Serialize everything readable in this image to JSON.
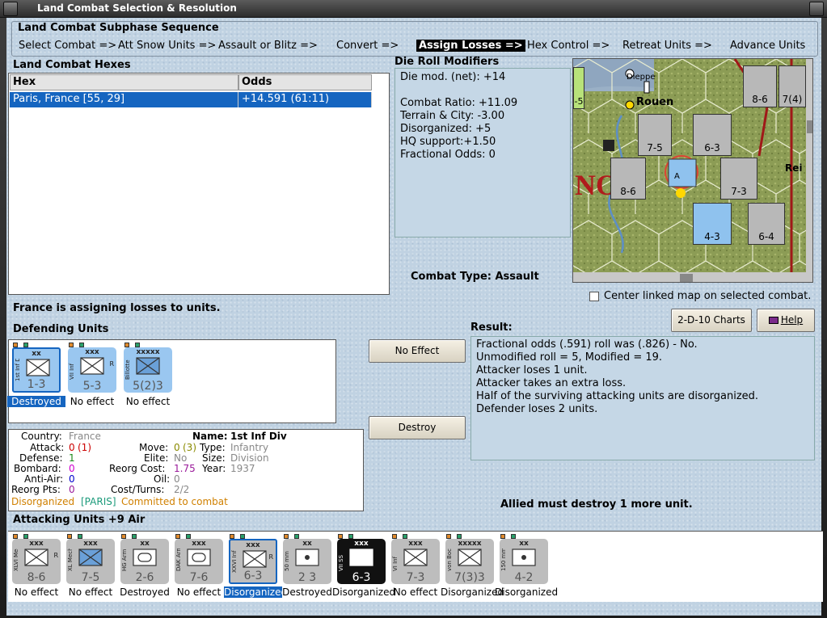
{
  "window": {
    "title": "Land Combat Selection & Resolution"
  },
  "sequence": {
    "header": "Land Combat Subphase Sequence",
    "steps": [
      {
        "label": "Select Combat =>"
      },
      {
        "label": "Att Snow Units =>"
      },
      {
        "label": "Assault or Blitz =>"
      },
      {
        "label": "Convert =>"
      },
      {
        "label": "Assign Losses =>"
      },
      {
        "label": "Hex Control =>"
      },
      {
        "label": "Retreat Units =>"
      },
      {
        "label": "Advance Units"
      }
    ],
    "active_step": "Assign Losses =>"
  },
  "hexes": {
    "header": "Land Combat Hexes",
    "columns": [
      "Hex",
      "Odds"
    ],
    "rows": [
      {
        "hex": "Paris, France [55, 29]",
        "odds": "+14.591 (61:11)"
      }
    ]
  },
  "drm": {
    "header": "Die Roll Modifiers",
    "lines": [
      "Die mod. (net): +14",
      "Combat Ratio: +11.09",
      "Terrain & City: -3.00",
      "Disorganized: +5",
      "HQ support:+1.50",
      "Fractional Odds: 0"
    ]
  },
  "combat_type": "Combat Type:  Assault",
  "center_map": {
    "label": "Center linked map on selected combat.",
    "checked": false
  },
  "buttons": {
    "charts": "2-D-10 Charts",
    "help": "Help",
    "no_effect": "No Effect",
    "destroy": "Destroy"
  },
  "status_msg": "France is assigning losses to units.",
  "defending": {
    "header": "Defending Units",
    "units": [
      {
        "name": "1st Inf Div",
        "size": "xx",
        "stats": "1-3",
        "status": "Destroyed",
        "color": "#9ac7f0",
        "mark": "x",
        "selected": true
      },
      {
        "name": "VII Inf",
        "size": "xxx",
        "stats": "5-3",
        "status": "No effect",
        "color": "#9ac7f0",
        "mark": "x",
        "reserve": "R"
      },
      {
        "name": "Billotte",
        "size": "xxxxx",
        "stats": "5(2)3",
        "status": "No effect",
        "color": "#9ac7f0",
        "mark": "xfill"
      }
    ]
  },
  "info": {
    "country_label": "Country:",
    "country": "France",
    "name_label": "Name:",
    "name": "1st Inf Div",
    "attack_label": "Attack:",
    "attack": "0",
    "attack_extra": "(1)",
    "move_label": "Move:",
    "move": "0",
    "move_extra": "(3)",
    "type_label": "Type:",
    "type": "Infantry",
    "defense_label": "Defense:",
    "defense": "1",
    "elite_label": "Elite:",
    "elite": "No",
    "size_label": "Size:",
    "size": "Division",
    "bombard_label": "Bombard:",
    "bombard": "0",
    "reorg_cost_label": "Reorg Cost:",
    "reorg_cost": "1.75",
    "year_label": "Year:",
    "year": "1937",
    "antiair_label": "Anti-Air:",
    "antiair": "0",
    "oil_label": "Oil:",
    "oil": "0",
    "reorg_pts_label": "Reorg Pts:",
    "reorg_pts": "0",
    "cost_turns_label": "Cost/Turns:",
    "cost_turns": "2/2",
    "disorganized": "Disorganized",
    "paris": "[PARIS]",
    "committed": "Committed to combat"
  },
  "result": {
    "header": "Result:",
    "lines": [
      "Fractional odds (.591) roll was (.826)  - No.",
      "Unmodified roll = 5, Modified = 19.",
      "Attacker loses 1 unit.",
      "Attacker takes an extra loss.",
      "Half of the surviving attacking units are disorganized.",
      "Defender loses 2 units."
    ]
  },
  "allied_msg": "Allied must destroy 1 more unit.",
  "attacking": {
    "header": "Attacking Units +9 Air",
    "units": [
      {
        "name": "XLVI Mech",
        "size": "xxx",
        "stats": "8-6",
        "status": "No effect",
        "color": "#bdbdbd",
        "mark": "x",
        "reserve": "R"
      },
      {
        "name": "XL Mech",
        "size": "xxx",
        "stats": "7-5",
        "status": "No effect",
        "color": "#bdbdbd",
        "mark": "xfill"
      },
      {
        "name": "HG Arm Div",
        "size": "xx",
        "stats": "2-6",
        "status": "Destroyed",
        "color": "#bdbdbd",
        "mark": "oval"
      },
      {
        "name": "DAK Arm",
        "size": "xxx",
        "stats": "7-6",
        "status": "No effect",
        "color": "#bdbdbd",
        "mark": "oval"
      },
      {
        "name": "XXVI Inf",
        "size": "xxx",
        "stats": "6-3",
        "status": "Disorganized",
        "color": "#bdbdbd",
        "mark": "x",
        "reserve": "R",
        "selected": true
      },
      {
        "name": "50 mm",
        "size": "xx",
        "stats": "2 3",
        "status": "Destroyed",
        "color": "#bdbdbd",
        "mark": "dot"
      },
      {
        "name": "VII SS",
        "size": "xxx",
        "stats": "6-3",
        "status": "Disorganized",
        "color": "#111111",
        "mark": "x"
      },
      {
        "name": "VI Inf",
        "size": "xxx",
        "stats": "7-3",
        "status": "No effect",
        "color": "#bdbdbd",
        "mark": "x"
      },
      {
        "name": "von Bock",
        "size": "xxxxx",
        "stats": "7(3)3",
        "status": "Disorganized",
        "color": "#bdbdbd",
        "mark": "x"
      },
      {
        "name": "150 mm",
        "size": "xx",
        "stats": "4-2",
        "status": "Disorganized",
        "color": "#bdbdbd",
        "mark": "dot"
      }
    ]
  },
  "map": {
    "labels": [
      "Dieppe",
      "Rouen",
      "Rei"
    ],
    "counters": [
      {
        "label": "8-6",
        "color": "#b8b8b8"
      },
      {
        "label": "7-5",
        "color": "#b8b8b8"
      },
      {
        "label": "6-3",
        "color": "#b8b8b8"
      },
      {
        "label": "8-6",
        "color": "#b8b8b8"
      },
      {
        "label": "7-3",
        "color": "#b8b8b8"
      },
      {
        "label": "4-3",
        "color": "#8fc2ee"
      },
      {
        "label": "6-4",
        "color": "#b8b8b8"
      },
      {
        "label": "7(4)",
        "color": "#b8b8b8"
      },
      {
        "label": "-5",
        "color": "#b8e27a"
      }
    ]
  }
}
